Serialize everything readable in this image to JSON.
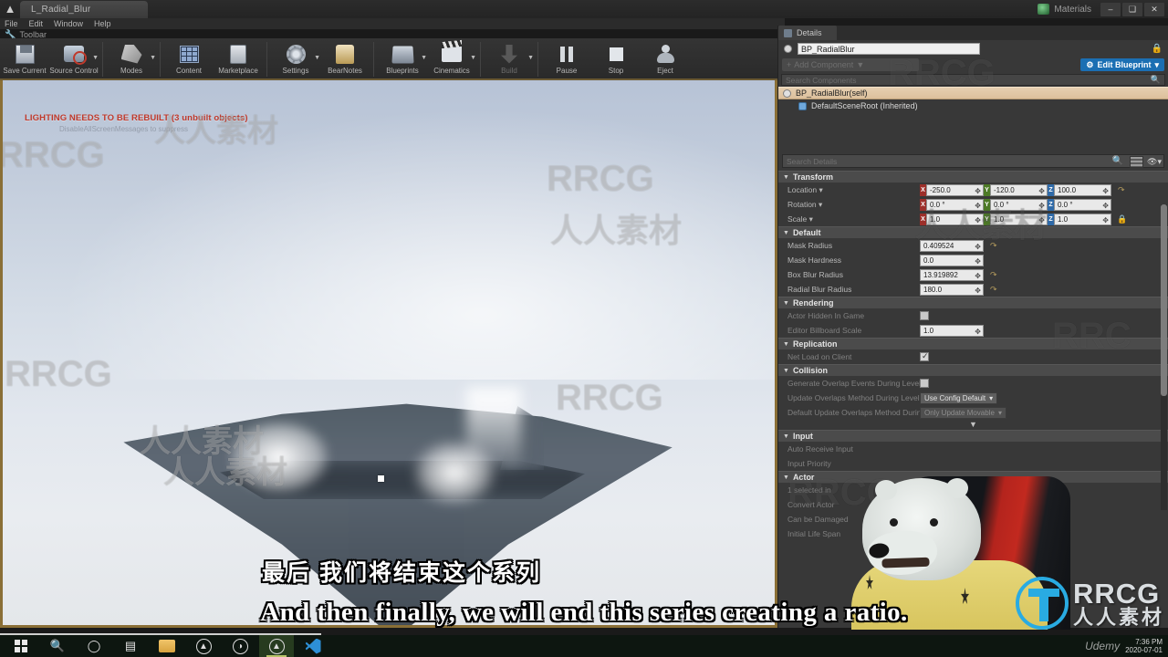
{
  "window": {
    "tab_title": "L_Radial_Blur",
    "logo_icon": "unreal-logo-icon",
    "right_tab_label": "Materials",
    "minimize_label": "–",
    "maximize_label": "❑",
    "close_label": "✕"
  },
  "menubar": {
    "items": [
      "File",
      "Edit",
      "Window",
      "Help"
    ],
    "toolbar_label": "Toolbar"
  },
  "toolbar": {
    "items": [
      {
        "label": "Save Current",
        "icon": "save-icon",
        "caret": false,
        "dim": false
      },
      {
        "label": "Source Control",
        "icon": "source-control-icon",
        "caret": true,
        "dim": false
      },
      {
        "label": "Modes",
        "icon": "modes-icon",
        "caret": true,
        "dim": false
      },
      {
        "label": "Content",
        "icon": "content-browser-icon",
        "caret": false,
        "dim": false
      },
      {
        "label": "Marketplace",
        "icon": "marketplace-icon",
        "caret": false,
        "dim": false
      },
      {
        "label": "Settings",
        "icon": "settings-gear-icon",
        "caret": true,
        "dim": false
      },
      {
        "label": "BearNotes",
        "icon": "bear-notes-icon",
        "caret": false,
        "dim": false
      },
      {
        "label": "Blueprints",
        "icon": "blueprints-icon",
        "caret": true,
        "dim": false
      },
      {
        "label": "Cinematics",
        "icon": "cinematics-icon",
        "caret": true,
        "dim": false
      },
      {
        "label": "Build",
        "icon": "build-icon",
        "caret": true,
        "dim": true
      },
      {
        "label": "Pause",
        "icon": "pause-icon",
        "caret": false,
        "dim": false
      },
      {
        "label": "Stop",
        "icon": "stop-icon",
        "caret": false,
        "dim": false
      },
      {
        "label": "Eject",
        "icon": "eject-icon",
        "caret": false,
        "dim": false
      }
    ]
  },
  "viewport": {
    "warning": "LIGHTING NEEDS TO BE REBUILT (3 unbuilt objects)",
    "warning_sub": "DisableAllScreenMessages to suppress"
  },
  "details": {
    "tab_label": "Details",
    "tab_icon": "details-panel-icon",
    "actor_name": "BP_RadialBlur",
    "lock_icon": "lock-details-icon",
    "add_component_label": "Add Component",
    "edit_blueprint_label": "Edit Blueprint",
    "edit_blueprint_icon": "blueprint-icon",
    "search_components_placeholder": "Search Components",
    "search_details_placeholder": "Search Details",
    "components": [
      {
        "label": "BP_RadialBlur(self)",
        "selected": true,
        "icon": "actor-icon"
      },
      {
        "label": "DefaultSceneRoot (Inherited)",
        "selected": false,
        "icon": "scene-root-icon"
      }
    ],
    "sections": [
      {
        "name": "Transform",
        "type": "vectors",
        "rows": [
          {
            "label": "Location",
            "dropdown": true,
            "values": [
              "-250.0",
              "-120.0",
              "100.0"
            ],
            "revert": true,
            "lock": false
          },
          {
            "label": "Rotation",
            "dropdown": true,
            "values": [
              "0.0 °",
              "0.0 °",
              "0.0 °"
            ],
            "revert": false,
            "lock": false
          },
          {
            "label": "Scale",
            "dropdown": true,
            "values": [
              "1.0",
              "1.0",
              "1.0"
            ],
            "revert": false,
            "lock": true
          }
        ]
      },
      {
        "name": "Default",
        "type": "fields",
        "rows": [
          {
            "label": "Mask Radius",
            "value": "0.409524",
            "revert": true
          },
          {
            "label": "Mask Hardness",
            "value": "0.0",
            "revert": false
          },
          {
            "label": "Box Blur Radius",
            "value": "13.919892",
            "revert": true
          },
          {
            "label": "Radial Blur Radius",
            "value": "180.0",
            "revert": true
          }
        ]
      },
      {
        "name": "Rendering",
        "type": "mixed",
        "rows": [
          {
            "label": "Actor Hidden In Game",
            "control": "checkbox",
            "checked": false
          },
          {
            "label": "Editor Billboard Scale",
            "control": "field",
            "value": "1.0"
          }
        ]
      },
      {
        "name": "Replication",
        "type": "mixed",
        "rows": [
          {
            "label": "Net Load on Client",
            "control": "checkbox",
            "checked": true
          }
        ]
      },
      {
        "name": "Collision",
        "type": "mixed",
        "rows": [
          {
            "label": "Generate Overlap Events During Level St",
            "control": "checkbox",
            "checked": false,
            "dim": true
          },
          {
            "label": "Update Overlaps Method During Level St",
            "control": "dropdown",
            "value": "Use Config Default",
            "dim": true
          },
          {
            "label": "Default Update Overlaps Method During",
            "control": "dropdown",
            "value": "Only Update Movable",
            "dim": true,
            "disabled": true
          }
        ]
      },
      {
        "name": "Input",
        "type": "labels",
        "rows": [
          {
            "label": "Auto Receive Input"
          },
          {
            "label": "Input Priority"
          }
        ]
      },
      {
        "name": "Actor",
        "type": "labels",
        "rows": [
          {
            "label": "1 selected in"
          },
          {
            "label": "Convert Actor"
          },
          {
            "label": "Can be Damaged"
          },
          {
            "label": "Initial Life Span"
          }
        ]
      }
    ],
    "more_arrow": "▼"
  },
  "subtitles": {
    "chinese": "最后 我们将结束这个系列",
    "english": "And then finally, we will end this series creating a ratio."
  },
  "branding": {
    "logo_text": "RRCG",
    "logo_sub": "人人素材",
    "logo_color": "#29abe2",
    "watermarks": [
      "RRCG",
      "人人素材"
    ]
  },
  "taskbar": {
    "items": [
      {
        "name": "start-button",
        "icon": "windows-logo-icon"
      },
      {
        "name": "search-button",
        "icon": "search-icon"
      },
      {
        "name": "cortana-button",
        "icon": "circle-icon"
      },
      {
        "name": "task-view-button",
        "icon": "task-view-icon"
      },
      {
        "name": "file-explorer-button",
        "icon": "folder-icon"
      },
      {
        "name": "unreal-engine-button",
        "icon": "unreal-logo-icon"
      },
      {
        "name": "substance-button",
        "icon": "substance-icon"
      },
      {
        "name": "unreal-project-button",
        "icon": "unreal-logo-icon"
      },
      {
        "name": "vscode-button",
        "icon": "vscode-icon"
      }
    ],
    "clock_time": "7:36 PM",
    "clock_date": "2020-07-01",
    "tray_brand": "Udemy"
  },
  "colors": {
    "accent_blue": "#1b6fb3",
    "selection_tan": "#e0c49f",
    "axis_x": "#9c2f2a",
    "axis_y": "#4d7a26",
    "axis_z": "#2f6aa8",
    "warning_red": "#c0392b",
    "viewport_border": "#8a6f36"
  }
}
